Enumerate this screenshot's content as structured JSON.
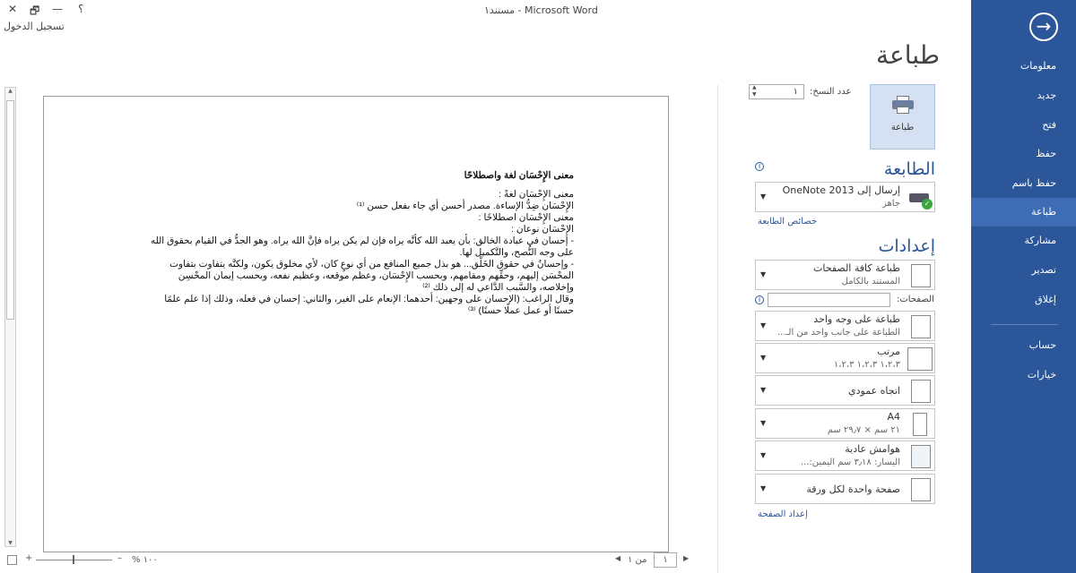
{
  "window": {
    "title": "مستند١ - Microsoft Word",
    "help": "؟",
    "minimize": "—",
    "restore": "🗗",
    "close": "✕",
    "signin": "تسجيل الدخول"
  },
  "sidebar": {
    "back": "→",
    "items": [
      "معلومات",
      "جديد",
      "فتح",
      "حفظ",
      "حفظ باسم",
      "طباعة",
      "مشاركة",
      "تصدير",
      "إغلاق"
    ],
    "items2": [
      "حساب",
      "خيارات"
    ],
    "selected": "طباعة"
  },
  "print": {
    "title": "طباعة",
    "button": "طباعة",
    "copies_label": "عدد النسخ:",
    "copies": "١",
    "printer_heading": "الطابعة",
    "printer_name": "إرسال إلى OneNote 2013",
    "printer_status": "جاهز",
    "printer_props": "خصائص الطابعة",
    "settings_heading": "إعدادات",
    "pages_label": "الصفحات:",
    "pages_value": "",
    "settings": [
      {
        "l1": "طباعة كافة الصفحات",
        "l2": "المستند بالكامل"
      },
      {
        "l1": "طباعة على وجه واحد",
        "l2": "الطباعة على جانب واحد من الـ..."
      },
      {
        "l1": "مرتب",
        "l2": "١،٢،٣    ١،٢،٣    ١،٢،٣"
      },
      {
        "l1": "اتجاه عمودي",
        "l2": ""
      },
      {
        "l1": "A4",
        "l2": "٢١ سم × ٢٩٫٧ سم"
      },
      {
        "l1": "هوامش عادية",
        "l2": "اليسار: ٣٫١٨ سم   اليمين:..."
      },
      {
        "l1": "صفحة واحدة لكل ورقة",
        "l2": ""
      }
    ],
    "page_setup": "إعداد الصفحة"
  },
  "document": {
    "heading": "معنى الإِحْسَان لغة واصطلاحًا",
    "lines": [
      "معنى الإِحْسَان لغةً :",
      "الإِحْسَان ضِدُّ الإساءة. مصدر أحسن أي جاء بفعل حسن ⁽¹⁾",
      "معنى الإِحْسَان اصطلاحًا :",
      "الإِحْسَان نوعان :",
      "- إحسان في عبادة الخالق: بأن يعبد الله كأنَّه يراه فإن لم يكن يراه فإنَّ الله يراه. وهو الجدُّ في القيام بحقوق الله على وجه النُّصح، والتَّكميل لها.",
      "- وإحسانٌ في حقوق الخَلْق... هو بذل جميع المنافع من أي نوعٍ كان، لأي مخلوق يكون، ولكنَّه يتفاوت بتفاوت المحْسَن إليهم، وحقِّهم ومقامهم، وبحسب الإِحْسَان، وعظم موقعه، وعظيم نفعه، وبحسب إيمان المحْسِن وإخلاصه، والسَّبب الدَّاعي له إلى ذلك ⁽²⁾",
      "وقال الراغب: (الإحسان على وجهين: أحدهما: الإنعام على الغير، والثاني: إحسان في فعله، وذلك إذا علم علمًا حسنًا أو عمل عملًا حسنًا) ⁽³⁾"
    ]
  },
  "status": {
    "page_current": "١",
    "page_of": "من ١",
    "zoom": "% ١٠٠",
    "zoom_percent": 100
  }
}
